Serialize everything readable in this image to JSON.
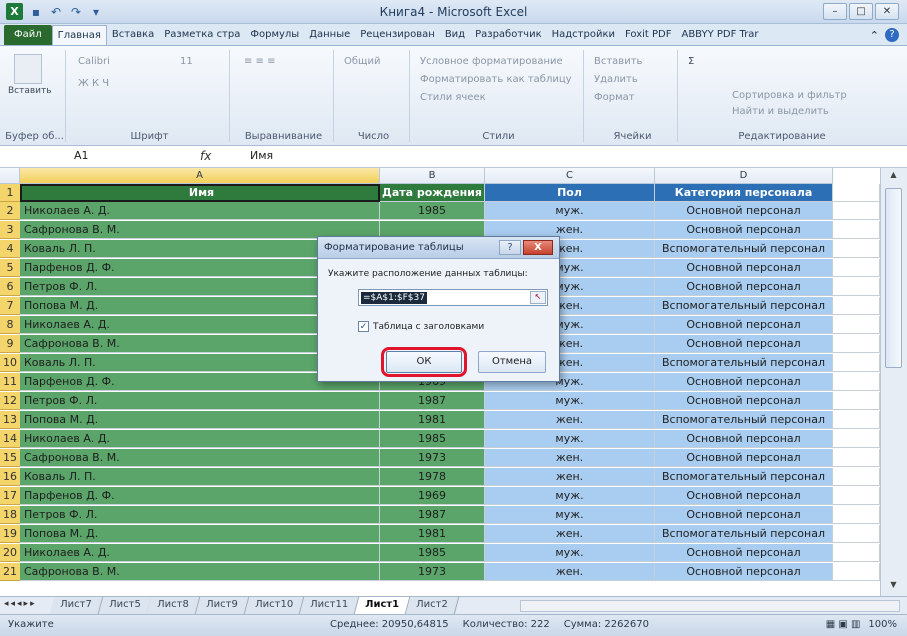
{
  "window": {
    "title": "Книга4  -  Microsoft Excel"
  },
  "ribbon_tabs": [
    "Файл",
    "Главная",
    "Вставка",
    "Разметка стра",
    "Формулы",
    "Данные",
    "Рецензирован",
    "Вид",
    "Разработчик",
    "Надстройки",
    "Foxit PDF",
    "ABBYY PDF Trar"
  ],
  "ribbon": {
    "clipboard": {
      "paste": "Вставить",
      "label": "Буфер об..."
    },
    "font": {
      "name": "Calibri",
      "size": "11",
      "label": "Шрифт"
    },
    "alignment": {
      "label": "Выравнивание"
    },
    "number": {
      "format": "Общий",
      "label": "Число"
    },
    "styles": {
      "cond": "Условное форматирование",
      "as_table": "Форматировать как таблицу",
      "cell_styles": "Стили ячеек",
      "label": "Стили"
    },
    "cells": {
      "insert": "Вставить",
      "delete": "Удалить",
      "format": "Формат",
      "label": "Ячейки"
    },
    "editing": {
      "sort": "Сортировка и фильтр",
      "find": "Найти и выделить",
      "label": "Редактирование"
    }
  },
  "formula_bar": {
    "name_box": "A1",
    "fx": "fx",
    "content": "Имя"
  },
  "columns": [
    "A",
    "B",
    "C",
    "D"
  ],
  "headers": {
    "a": "Имя",
    "b": "Дата рождения",
    "c": "Пол",
    "d": "Категория персонала"
  },
  "rows": [
    {
      "n": "2",
      "a": "Николаев А. Д.",
      "b": "1985",
      "c": "муж.",
      "d": "Основной персонал"
    },
    {
      "n": "3",
      "a": "Сафронова В. М.",
      "b": "",
      "c": "жен.",
      "d": "Основной персонал"
    },
    {
      "n": "4",
      "a": "Коваль Л. П.",
      "b": "",
      "c": "жен.",
      "d": "Вспомогательный персонал"
    },
    {
      "n": "5",
      "a": "Парфенов Д. Ф.",
      "b": "",
      "c": "муж.",
      "d": "Основной персонал"
    },
    {
      "n": "6",
      "a": "Петров Ф. Л.",
      "b": "",
      "c": "муж.",
      "d": "Основной персонал"
    },
    {
      "n": "7",
      "a": "Попова М. Д.",
      "b": "",
      "c": "жен.",
      "d": "Вспомогательный персонал"
    },
    {
      "n": "8",
      "a": "Николаев А. Д.",
      "b": "",
      "c": "муж.",
      "d": "Основной персонал"
    },
    {
      "n": "9",
      "a": "Сафронова В. М.",
      "b": "",
      "c": "жен.",
      "d": "Основной персонал"
    },
    {
      "n": "10",
      "a": "Коваль Л. П.",
      "b": "",
      "c": "жен.",
      "d": "Вспомогательный персонал"
    },
    {
      "n": "11",
      "a": "Парфенов Д. Ф.",
      "b": "1969",
      "c": "муж.",
      "d": "Основной персонал"
    },
    {
      "n": "12",
      "a": "Петров Ф. Л.",
      "b": "1987",
      "c": "муж.",
      "d": "Основной персонал"
    },
    {
      "n": "13",
      "a": "Попова М. Д.",
      "b": "1981",
      "c": "жен.",
      "d": "Вспомогательный персонал"
    },
    {
      "n": "14",
      "a": "Николаев А. Д.",
      "b": "1985",
      "c": "муж.",
      "d": "Основной персонал"
    },
    {
      "n": "15",
      "a": "Сафронова В. М.",
      "b": "1973",
      "c": "жен.",
      "d": "Основной персонал"
    },
    {
      "n": "16",
      "a": "Коваль Л. П.",
      "b": "1978",
      "c": "жен.",
      "d": "Вспомогательный персонал"
    },
    {
      "n": "17",
      "a": "Парфенов Д. Ф.",
      "b": "1969",
      "c": "муж.",
      "d": "Основной персонал"
    },
    {
      "n": "18",
      "a": "Петров Ф. Л.",
      "b": "1987",
      "c": "муж.",
      "d": "Основной персонал"
    },
    {
      "n": "19",
      "a": "Попова М. Д.",
      "b": "1981",
      "c": "жен.",
      "d": "Вспомогательный персонал"
    },
    {
      "n": "20",
      "a": "Николаев А. Д.",
      "b": "1985",
      "c": "муж.",
      "d": "Основной персонал"
    },
    {
      "n": "21",
      "a": "Сафронова В. М.",
      "b": "1973",
      "c": "жен.",
      "d": "Основной персонал"
    }
  ],
  "sheet_tabs": [
    "Лист7",
    "Лист5",
    "Лист8",
    "Лист9",
    "Лист10",
    "Лист11",
    "Лист1",
    "Лист2"
  ],
  "active_sheet": "Лист1",
  "status": {
    "ready": "Укажите",
    "average": "Среднее: 20950,64815",
    "count": "Количество: 222",
    "sum": "Сумма: 2262670",
    "zoom": "100%"
  },
  "dialog": {
    "title": "Форматирование таблицы",
    "help": "?",
    "close": "X",
    "prompt": "Укажите расположение данных таблицы:",
    "range": "=$A$1:$F$37",
    "checkbox_label": "Таблица с заголовками",
    "checkbox_checked": true,
    "ok": "ОК",
    "cancel": "Отмена"
  },
  "colors": {
    "green_fill": "#5ba56a",
    "blue_fill": "#a9cdf0",
    "row_header": "#f4d56b",
    "highlight_ring": "#e0142b"
  }
}
